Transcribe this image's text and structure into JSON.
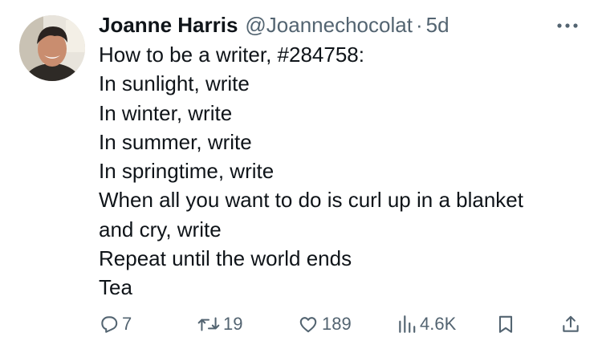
{
  "tweet": {
    "author": {
      "name": "Joanne Harris",
      "handle": "@Joannechocolat",
      "separator": "·",
      "time": "5d"
    },
    "text_lines": [
      "How to be a writer, #284758:",
      "In sunlight, write",
      "In winter, write",
      "In summer, write",
      "In springtime, write",
      "When all you want to do is curl up in a blanket",
      "and cry, write",
      "Repeat until the world ends",
      "Tea"
    ],
    "actions": {
      "replies": "7",
      "retweets": "19",
      "likes": "189",
      "views": "4.6K"
    }
  },
  "icons": {
    "more": "more-horizontal-icon",
    "reply": "reply-icon",
    "retweet": "retweet-icon",
    "like": "heart-icon",
    "views": "views-bar-chart-icon",
    "bookmark": "bookmark-icon",
    "share": "share-upload-icon"
  },
  "colors": {
    "text": "#0f1419",
    "secondary": "#536471",
    "background": "#ffffff"
  }
}
